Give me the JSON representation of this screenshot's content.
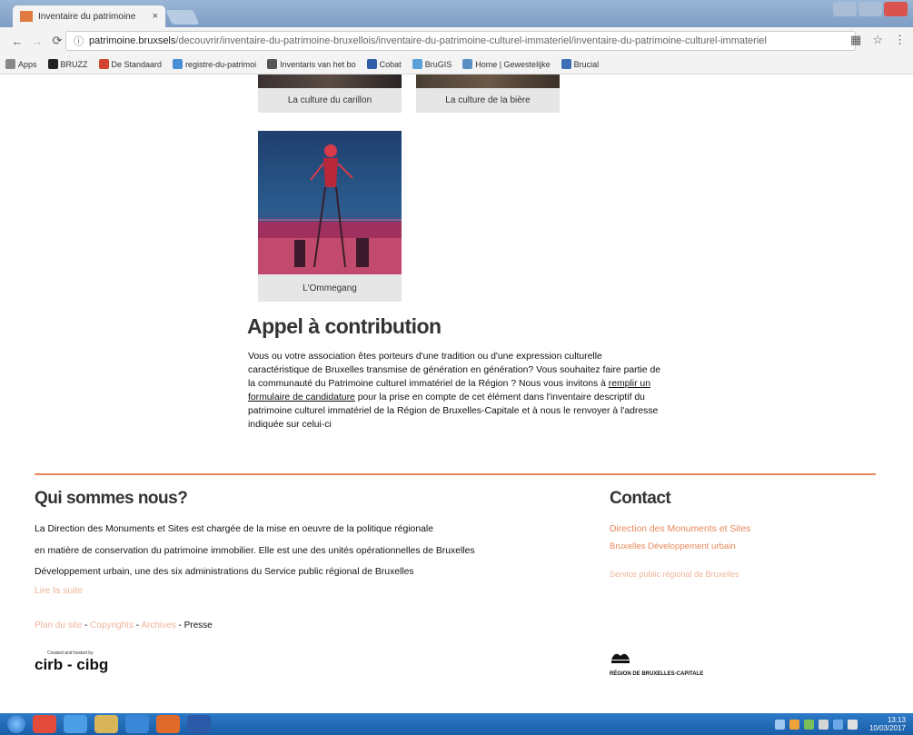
{
  "browser": {
    "tab_title": "Inventaire du patrimoine",
    "tab_close": "×",
    "url_host": "patrimoine.bruxsels",
    "url_path": "/decouvrir/inventaire-du-patrimoine-bruxellois/inventaire-du-patrimoine-culturel-immateriel/inventaire-du-patrimoine-culturel-immateriel",
    "bookmarks": [
      {
        "label": "Apps",
        "color": "#888888"
      },
      {
        "label": "BRUZZ",
        "color": "#222222"
      },
      {
        "label": "De Standaard",
        "color": "#d2452f"
      },
      {
        "label": "registre-du-patrimoi",
        "color": "#4a8fd6"
      },
      {
        "label": "Inventaris van het bo",
        "color": "#555555"
      },
      {
        "label": "Cobat",
        "color": "#2f5fa8"
      },
      {
        "label": "BruGIS",
        "color": "#59a0d9"
      },
      {
        "label": "Home | Gewestelijke",
        "color": "#5a8fc4"
      },
      {
        "label": "Brucial",
        "color": "#3a6fb8"
      }
    ]
  },
  "cards": [
    {
      "caption": "La culture du carillon"
    },
    {
      "caption": "La culture de la bière"
    },
    {
      "caption": "L'Ommegang"
    }
  ],
  "contribution": {
    "title": "Appel à contribution",
    "text_before_link": "Vous ou votre association êtes porteurs d'une tradition ou d'une expression culturelle caractéristique de Bruxelles transmise de génération en génération? Vous souhaitez faire partie de la communauté du Patrimoine culturel immatériel de la Région ? Nous vous invitons à ",
    "link_text": "remplir un formulaire de candidature",
    "text_after_link": " pour la prise en compte de cet élément dans l'inventaire descriptif du patrimoine culturel immatériel de la Région de Bruxelles-Capitale et à nous le renvoyer à l'adresse indiquée sur celui-ci"
  },
  "footer": {
    "about_title": "Qui sommes nous?",
    "about_lines": [
      "La Direction des Monuments et Sites est chargée de la mise en oeuvre de la politique régionale",
      "en matière de conservation du patrimoine immobilier. Elle est une des unités opérationnelles de Bruxelles",
      "Développement urbain, une des six administrations du Service public régional de Bruxelles"
    ],
    "read_more": "Lire la suite",
    "links": [
      "Plan du site",
      "Copyrights",
      "Archives",
      "Presse"
    ],
    "separator": " - ",
    "contact_title": "Contact",
    "contact_lines": [
      "Direction des Monuments et Sites",
      "Bruxelles Développement urbain"
    ],
    "contact_service": "Service public régional de Bruxelles",
    "cirb_small": "Created and hosted by",
    "cirb_logo": "cirb - cibg",
    "region_logo": "RÉGION DE BRUXELLES-CAPITALE"
  },
  "taskbar": {
    "time": "13:13",
    "date": "10/03/2017"
  },
  "colors": {
    "accent": "#e8875a",
    "accent_light": "#f0b49a",
    "taskbar": "#1a5ea6"
  }
}
